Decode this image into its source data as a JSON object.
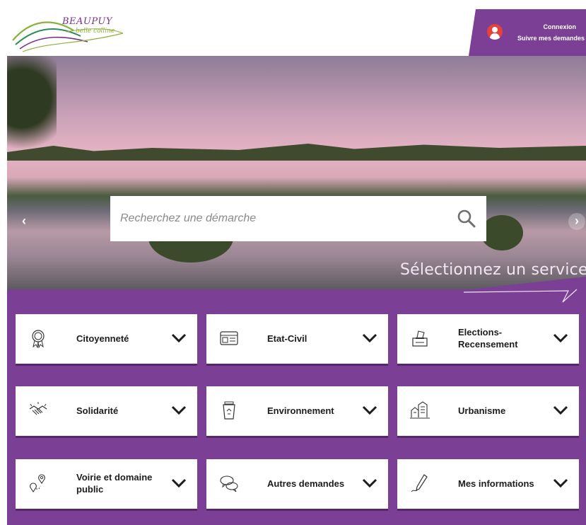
{
  "header": {
    "logo_title": "BEAUPUY",
    "logo_subtitle": "belle colline",
    "account": {
      "login_label": "Connexion",
      "requests_label": "Suivre mes demandes"
    }
  },
  "hero": {
    "search_placeholder": "Recherchez une démarche",
    "prev_label": "‹",
    "next_label": "›"
  },
  "services": {
    "title": "Sélectionnez un service",
    "items": [
      {
        "label": "Citoyenneté",
        "icon": "medal-icon"
      },
      {
        "label": "Etat-Civil",
        "icon": "id-card-icon"
      },
      {
        "label": "Elections-\nRecensement",
        "icon": "ballot-box-icon"
      },
      {
        "label": "Solidarité",
        "icon": "handshake-icon"
      },
      {
        "label": "Environnement",
        "icon": "recycle-bin-icon"
      },
      {
        "label": "Urbanisme",
        "icon": "buildings-icon"
      },
      {
        "label": "Voirie et domaine public",
        "icon": "map-pin-icon"
      },
      {
        "label": "Autres demandes",
        "icon": "speech-bubbles-icon"
      },
      {
        "label": "Mes informations",
        "icon": "pen-icon"
      }
    ]
  },
  "colors": {
    "brand_purple": "#7b3f96",
    "account_icon": "#e8413c",
    "logo_purple": "#7a2f8f",
    "logo_green": "#8bb23a"
  }
}
